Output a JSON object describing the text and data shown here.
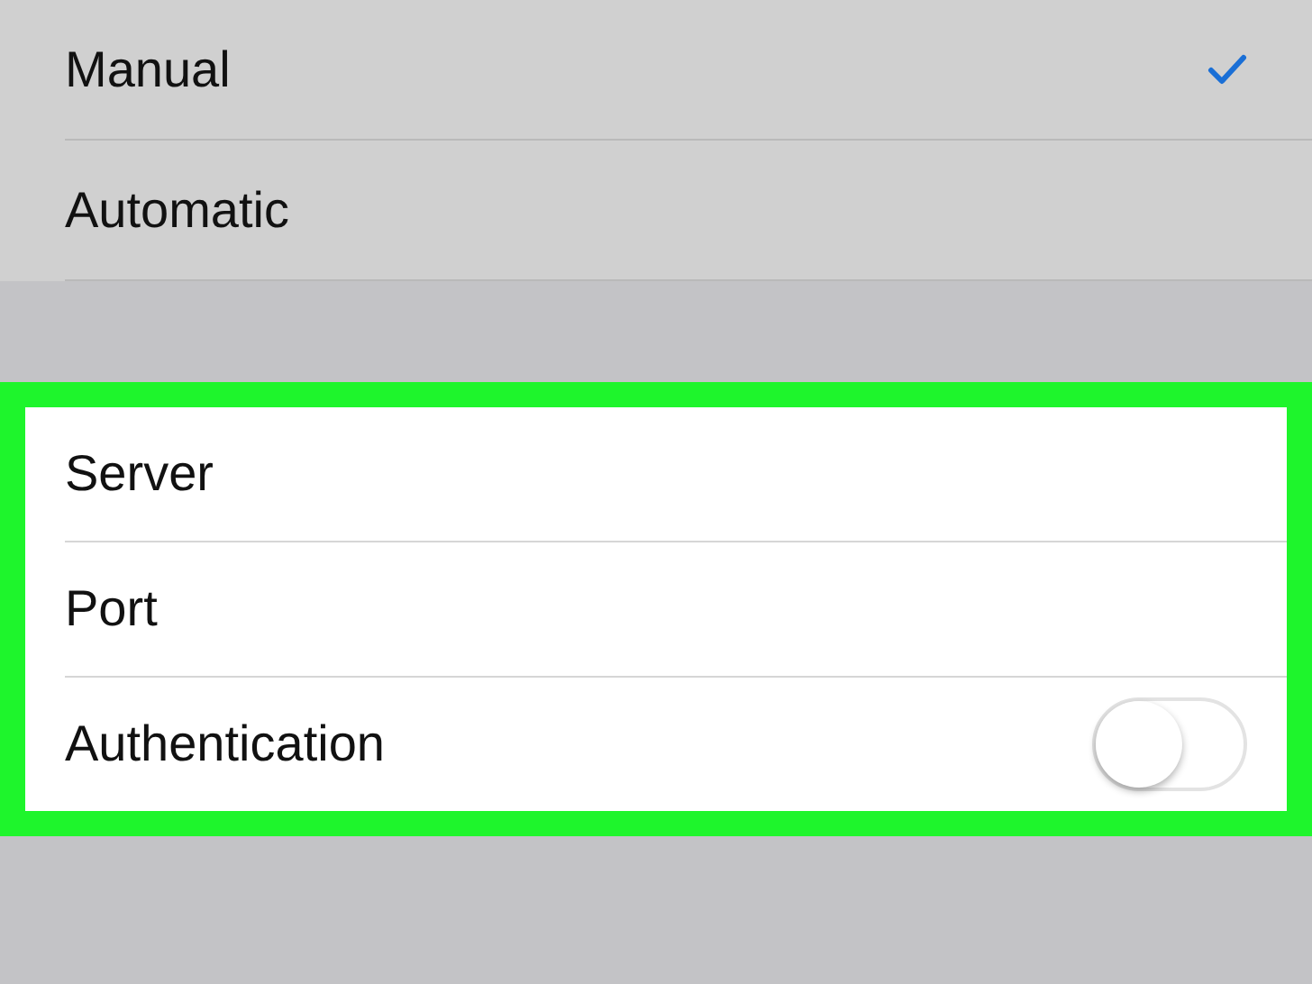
{
  "mode_options": [
    {
      "label": "Manual",
      "selected": true
    },
    {
      "label": "Automatic",
      "selected": false
    }
  ],
  "proxy_settings": {
    "highlighted": true,
    "rows": [
      {
        "kind": "field",
        "label": "Server"
      },
      {
        "kind": "field",
        "label": "Port"
      },
      {
        "kind": "toggle",
        "label": "Authentication",
        "on": false
      }
    ]
  }
}
